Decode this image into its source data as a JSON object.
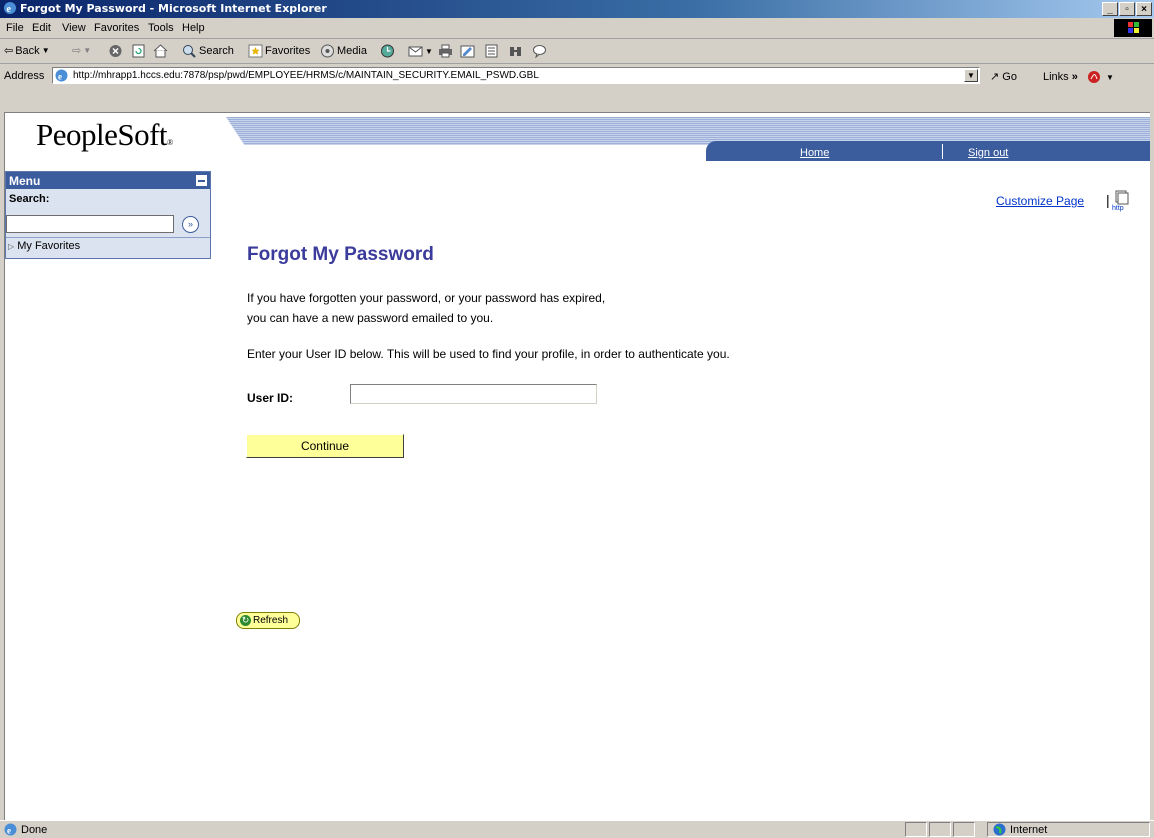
{
  "window": {
    "title": "Forgot My Password - Microsoft Internet Explorer"
  },
  "menubar": {
    "items": [
      "File",
      "Edit",
      "View",
      "Favorites",
      "Tools",
      "Help"
    ]
  },
  "toolbar": {
    "back": "Back",
    "search": "Search",
    "favorites": "Favorites",
    "media": "Media"
  },
  "address": {
    "label": "Address",
    "url": "http://mhrapp1.hccs.edu:7878/psp/pwd/EMPLOYEE/HRMS/c/MAINTAIN_SECURITY.EMAIL_PSWD.GBL",
    "go": "Go",
    "links": "Links"
  },
  "header": {
    "logo": "PeopleSoft",
    "home": "Home",
    "signout": "Sign out"
  },
  "menu": {
    "title": "Menu",
    "search_label": "Search:",
    "favorites": "My Favorites"
  },
  "page": {
    "customize": "Customize Page",
    "title": "Forgot My Password",
    "line1": "If you have forgotten your password, or your password has expired,",
    "line2": "you can have a new password emailed to you.",
    "line3": "Enter your User ID below. This will be used to find your profile, in order to authenticate you.",
    "userid_label": "User ID:",
    "userid_value": "",
    "continue": "Continue",
    "refresh": "Refresh"
  },
  "status": {
    "left": "Done",
    "zone": "Internet"
  },
  "colors": {
    "titlebar": "#0a246a",
    "banner": "#3b5c9d",
    "heading": "#3b3b9b",
    "button": "#ffff99",
    "link": "#0033cc"
  }
}
